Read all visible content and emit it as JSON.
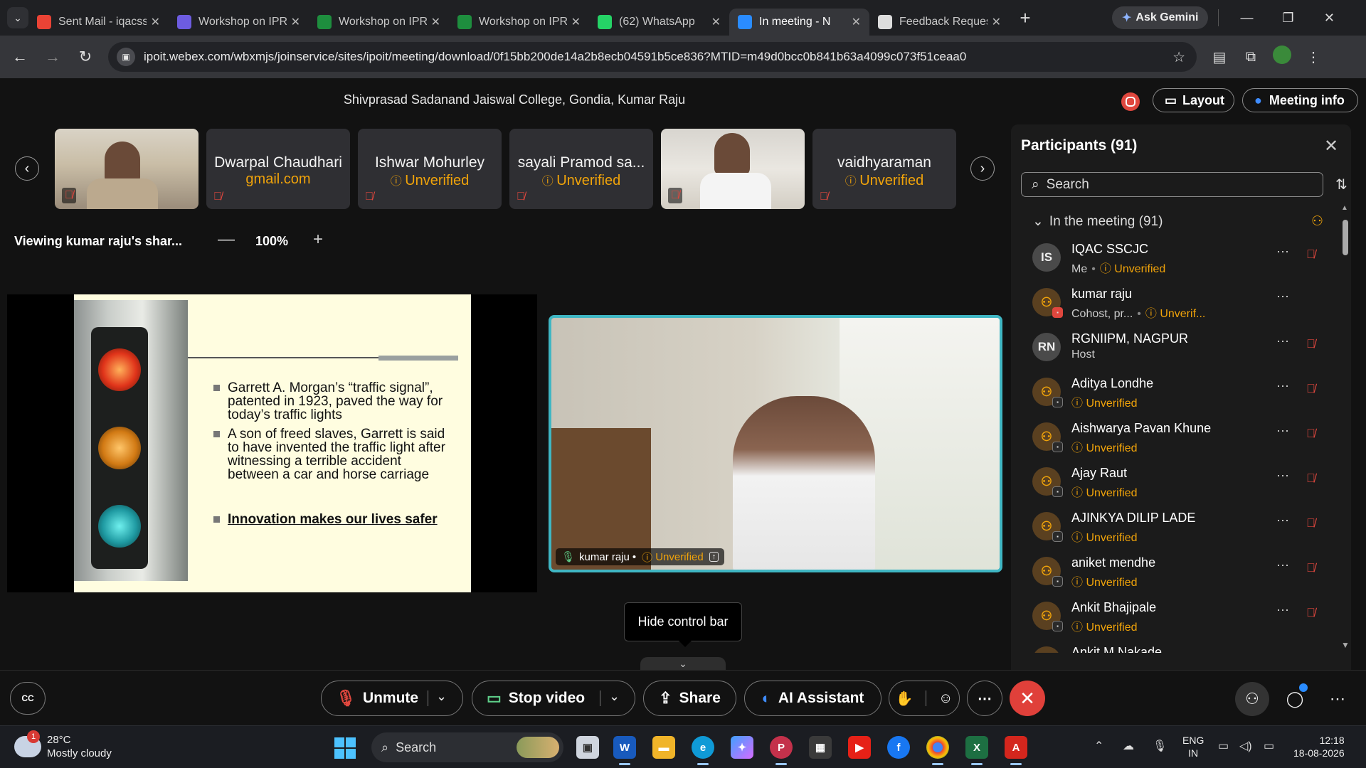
{
  "browser": {
    "tabs": [
      {
        "title": "Sent Mail - iqacss",
        "icon": "gmail-icon",
        "color": "#ea4335"
      },
      {
        "title": "Workshop on IPR",
        "icon": "forms-icon",
        "color": "#6d5ce0"
      },
      {
        "title": "Workshop on IPR",
        "icon": "sheets-icon",
        "color": "#1e8e3e"
      },
      {
        "title": "Workshop on IPR",
        "icon": "sheets-icon",
        "color": "#1e8e3e"
      },
      {
        "title": "(62) WhatsApp",
        "icon": "whatsapp-icon",
        "color": "#25d366"
      },
      {
        "title": "In meeting - N",
        "icon": "webex-icon",
        "color": "#2a8cff",
        "active": true
      },
      {
        "title": "Feedback Reques",
        "icon": "chatgpt-icon",
        "color": "#dddddd"
      }
    ],
    "gemini_label": "Ask Gemini",
    "url": "ipoit.webex.com/wbxmjs/joinservice/sites/ipoit/meeting/download/0f15bb200de14a2b8ecb04591b5ce836?MTID=m49d0bcc0b841b63a4099c073f51ceaa0"
  },
  "meeting": {
    "title": "Shivprasad Sadanand Jaiswal College, Gondia, Kumar Raju",
    "layout_label": "Layout",
    "info_label": "Meeting info"
  },
  "strip": [
    {
      "type": "video",
      "cam": "cam1"
    },
    {
      "type": "name",
      "name": "Dwarpal Chaudhari",
      "sub": "gmail.com"
    },
    {
      "type": "name",
      "name": "Ishwar Mohurley",
      "sub": "Unverified"
    },
    {
      "type": "name",
      "name": "sayali Pramod sa...",
      "sub": "Unverified"
    },
    {
      "type": "video",
      "cam": "cam2"
    },
    {
      "type": "name",
      "name": "vaidhyaraman",
      "sub": "Unverified"
    }
  ],
  "share": {
    "viewing_label": "Viewing kumar raju's shar...",
    "zoom": "100%",
    "slide_bullets": [
      "Garrett A. Morgan’s “traffic signal”, patented in 1923, paved the way for today’s traffic lights",
      "A son of freed slaves, Garrett is said to have invented the traffic light after witnessing a terrible accident between a car and horse carriage"
    ],
    "slide_emphasis": "Innovation makes our lives safer"
  },
  "active_video": {
    "name": "kumar raju",
    "status": "Unverified"
  },
  "tooltip": "Hide control bar",
  "controls": {
    "unmute": "Unmute",
    "stop_video": "Stop video",
    "share": "Share",
    "ai_assistant": "AI Assistant"
  },
  "participants": {
    "title": "Participants (91)",
    "search_placeholder": "Search",
    "section": "In the meeting (91)",
    "list": [
      {
        "initials": "IS",
        "name": "IQAC SSCJC",
        "role": "Me",
        "status": "Unverified",
        "muted": true
      },
      {
        "initials": "",
        "name": "kumar raju",
        "role": "Cohost, pr...",
        "status": "Unverif...",
        "muted": false,
        "badge": "red"
      },
      {
        "initials": "RN",
        "name": "RGNIIPM, NAGPUR",
        "role": "Host",
        "status": "",
        "muted": true
      },
      {
        "initials": "",
        "name": "Aditya Londhe",
        "role": "",
        "status": "Unverified",
        "muted": true
      },
      {
        "initials": "",
        "name": "Aishwarya Pavan Khune",
        "role": "",
        "status": "Unverified",
        "muted": true
      },
      {
        "initials": "",
        "name": "Ajay Raut",
        "role": "",
        "status": "Unverified",
        "muted": true
      },
      {
        "initials": "",
        "name": "AJINKYA DILIP LADE",
        "role": "",
        "status": "Unverified",
        "muted": true
      },
      {
        "initials": "",
        "name": "aniket mendhe",
        "role": "",
        "status": "Unverified",
        "muted": true
      },
      {
        "initials": "",
        "name": "Ankit Bhajipale",
        "role": "",
        "status": "Unverified",
        "muted": true
      },
      {
        "initials": "",
        "name": "Ankit M Nakade",
        "role": "",
        "status": "",
        "muted": false
      }
    ]
  },
  "taskbar": {
    "weather_temp": "28°C",
    "weather_desc": "Mostly cloudy",
    "weather_badge": "1",
    "search_label": "Search",
    "lang_top": "ENG",
    "lang_bottom": "IN",
    "time": "12:18",
    "date": "18-08-2026"
  }
}
